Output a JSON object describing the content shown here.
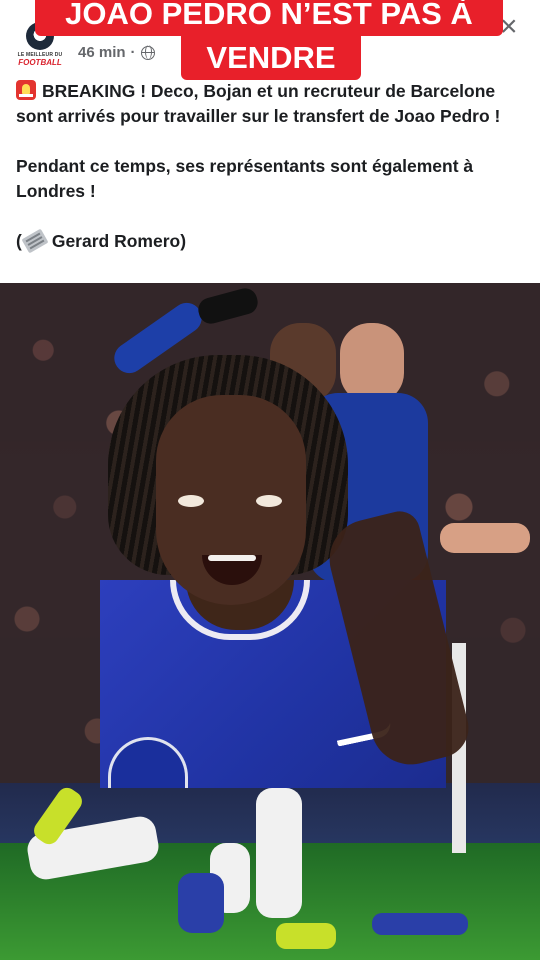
{
  "overlay": {
    "headline_line1": "JOAO PEDRO N’EST PAS À",
    "headline_line2": "VENDRE"
  },
  "post": {
    "page_logo_top": "LE MEILLEUR DU",
    "page_logo_bottom": "FOOTBALL",
    "time": "46 min",
    "separator": "·",
    "close_symbol": "×",
    "paragraph1": "BREAKING ! Deco, Bojan et un recruteur de Barcelone sont arrivés pour travailler sur le transfert de Joao Pedro !",
    "paragraph2": "Pendant ce temps, ses représentants sont également à Londres !",
    "source_open": "(",
    "source_name": "Gerard Romero)"
  },
  "icons": {
    "breaking": "police-siren-icon",
    "privacy": "globe-icon",
    "source": "newspaper-icon",
    "close": "close-icon"
  },
  "colors": {
    "headline_bg": "#e8202a",
    "headline_text": "#ffffff",
    "meta_text": "#65676b",
    "body_text": "#1c1e21",
    "jersey_blue": "#2033a3"
  }
}
